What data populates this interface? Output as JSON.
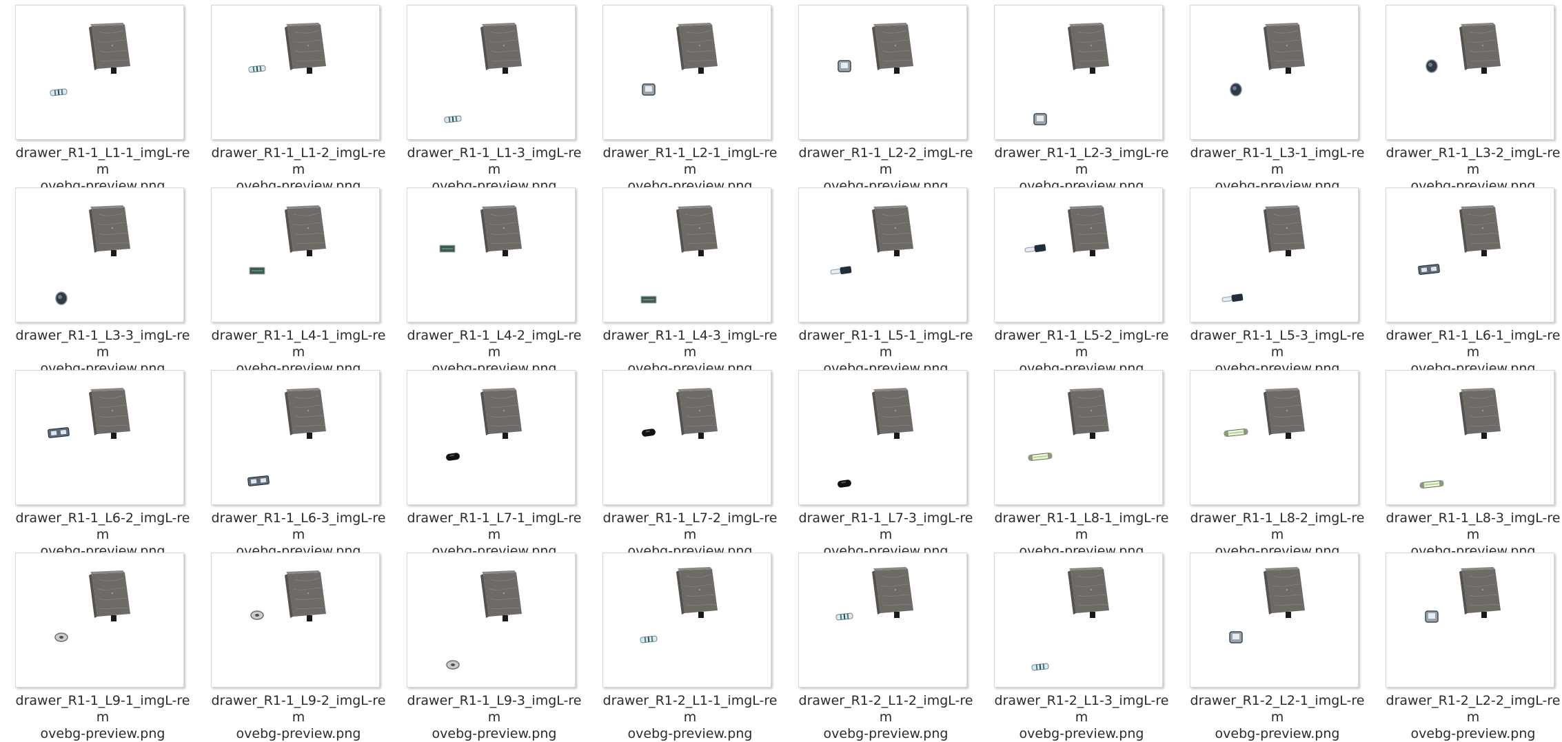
{
  "view": {
    "files": [
      {
        "line1": "drawer_R1-1_L1-1_imgL-rem",
        "line2": "ovebg-preview.png",
        "part_icon": "resistor-icon"
      },
      {
        "line1": "drawer_R1-1_L1-2_imgL-rem",
        "line2": "ovebg-preview.png",
        "part_icon": "resistor-icon"
      },
      {
        "line1": "drawer_R1-1_L1-3_imgL-rem",
        "line2": "ovebg-preview.png",
        "part_icon": "resistor-icon"
      },
      {
        "line1": "drawer_R1-1_L2-1_imgL-rem",
        "line2": "ovebg-preview.png",
        "part_icon": "capacitor-icon"
      },
      {
        "line1": "drawer_R1-1_L2-2_imgL-rem",
        "line2": "ovebg-preview.png",
        "part_icon": "capacitor-icon"
      },
      {
        "line1": "drawer_R1-1_L2-3_imgL-rem",
        "line2": "ovebg-preview.png",
        "part_icon": "capacitor-icon"
      },
      {
        "line1": "drawer_R1-1_L3-1_imgL-rem",
        "line2": "ovebg-preview.png",
        "part_icon": "knob-icon"
      },
      {
        "line1": "drawer_R1-1_L3-2_imgL-rem",
        "line2": "ovebg-preview.png",
        "part_icon": "knob-icon"
      },
      {
        "line1": "drawer_R1-1_L3-3_imgL-rem",
        "line2": "ovebg-preview.png",
        "part_icon": "knob-icon"
      },
      {
        "line1": "drawer_R1-1_L4-1_imgL-rem",
        "line2": "ovebg-preview.png",
        "part_icon": "chip-icon"
      },
      {
        "line1": "drawer_R1-1_L4-2_imgL-rem",
        "line2": "ovebg-preview.png",
        "part_icon": "chip-icon"
      },
      {
        "line1": "drawer_R1-1_L4-3_imgL-rem",
        "line2": "ovebg-preview.png",
        "part_icon": "chip-icon"
      },
      {
        "line1": "drawer_R1-1_L5-1_imgL-rem",
        "line2": "ovebg-preview.png",
        "part_icon": "fuse-icon"
      },
      {
        "line1": "drawer_R1-1_L5-2_imgL-rem",
        "line2": "ovebg-preview.png",
        "part_icon": "fuse-icon"
      },
      {
        "line1": "drawer_R1-1_L5-3_imgL-rem",
        "line2": "ovebg-preview.png",
        "part_icon": "fuse-icon"
      },
      {
        "line1": "drawer_R1-1_L6-1_imgL-rem",
        "line2": "ovebg-preview.png",
        "part_icon": "connector-icon"
      },
      {
        "line1": "drawer_R1-1_L6-2_imgL-rem",
        "line2": "ovebg-preview.png",
        "part_icon": "connector-icon"
      },
      {
        "line1": "drawer_R1-1_L6-3_imgL-rem",
        "line2": "ovebg-preview.png",
        "part_icon": "connector-icon"
      },
      {
        "line1": "drawer_R1-1_L7-1_imgL-rem",
        "line2": "ovebg-preview.png",
        "part_icon": "black-cap-icon"
      },
      {
        "line1": "drawer_R1-1_L7-2_imgL-rem",
        "line2": "ovebg-preview.png",
        "part_icon": "black-cap-icon"
      },
      {
        "line1": "drawer_R1-1_L7-3_imgL-rem",
        "line2": "ovebg-preview.png",
        "part_icon": "black-cap-icon"
      },
      {
        "line1": "drawer_R1-1_L8-1_imgL-rem",
        "line2": "ovebg-preview.png",
        "part_icon": "glass-fuse-icon"
      },
      {
        "line1": "drawer_R1-1_L8-2_imgL-rem",
        "line2": "ovebg-preview.png",
        "part_icon": "glass-fuse-icon"
      },
      {
        "line1": "drawer_R1-1_L8-3_imgL-rem",
        "line2": "ovebg-preview.png",
        "part_icon": "glass-fuse-icon"
      },
      {
        "line1": "drawer_R1-1_L9-1_imgL-rem",
        "line2": "ovebg-preview.png",
        "part_icon": "washer-icon"
      },
      {
        "line1": "drawer_R1-1_L9-2_imgL-rem",
        "line2": "ovebg-preview.png",
        "part_icon": "washer-icon"
      },
      {
        "line1": "drawer_R1-1_L9-3_imgL-rem",
        "line2": "ovebg-preview.png",
        "part_icon": "washer-icon"
      },
      {
        "line1": "drawer_R1-2_L1-1_imgL-rem",
        "line2": "ovebg-preview.png",
        "part_icon": "resistor-icon"
      },
      {
        "line1": "drawer_R1-2_L1-2_imgL-rem",
        "line2": "ovebg-preview.png",
        "part_icon": "resistor-icon"
      },
      {
        "line1": "drawer_R1-2_L1-3_imgL-rem",
        "line2": "ovebg-preview.png",
        "part_icon": "resistor-icon"
      },
      {
        "line1": "drawer_R1-2_L2-1_imgL-rem",
        "line2": "ovebg-preview.png",
        "part_icon": "capacitor-icon"
      },
      {
        "line1": "drawer_R1-2_L2-2_imgL-rem",
        "line2": "ovebg-preview.png",
        "part_icon": "capacitor-icon"
      }
    ]
  }
}
